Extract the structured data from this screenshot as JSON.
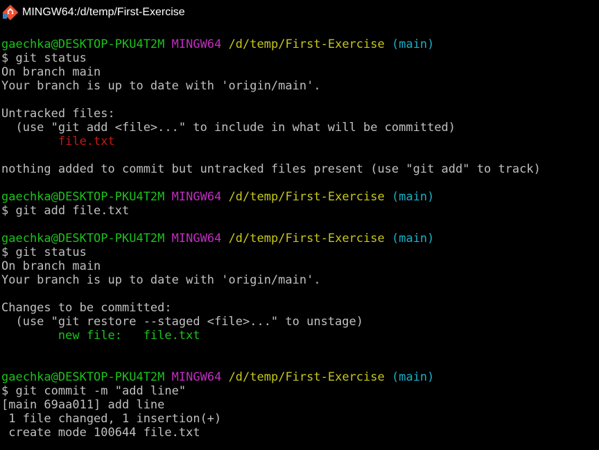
{
  "window": {
    "title": "MINGW64:/d/temp/First-Exercise",
    "icon": "git-bash-icon"
  },
  "colors": {
    "background": "#000000",
    "text": "#c0c0c0",
    "green": "#1cc21c",
    "magenta": "#c02dc0",
    "yellow": "#c8c81c",
    "cyan": "#1ab0c8",
    "red": "#c41818"
  },
  "prompt": {
    "user_host": "gaechka@DESKTOP-PKU4T2M",
    "shell": "MINGW64",
    "path": "/d/temp/First-Exercise",
    "branch": "(main)"
  },
  "terminal": {
    "lines": [
      [
        {
          "t": "gaechka@DESKTOP-PKU4T2M",
          "c": "green"
        },
        {
          "t": " ",
          "c": "white"
        },
        {
          "t": "MINGW64",
          "c": "magenta"
        },
        {
          "t": " ",
          "c": "white"
        },
        {
          "t": "/d/temp/First-Exercise",
          "c": "yellow"
        },
        {
          "t": " ",
          "c": "white"
        },
        {
          "t": "(main)",
          "c": "cyan"
        }
      ],
      [
        {
          "t": "$ git status",
          "c": "white"
        }
      ],
      [
        {
          "t": "On branch main",
          "c": "white"
        }
      ],
      [
        {
          "t": "Your branch is up to date with 'origin/main'.",
          "c": "white"
        }
      ],
      [],
      [
        {
          "t": "Untracked files:",
          "c": "white"
        }
      ],
      [
        {
          "t": "  (use \"git add <file>...\" to include in what will be committed)",
          "c": "white"
        }
      ],
      [
        {
          "t": "        file.txt",
          "c": "red"
        }
      ],
      [],
      [
        {
          "t": "nothing added to commit but untracked files present (use \"git add\" to track)",
          "c": "white"
        }
      ],
      [],
      [
        {
          "t": "gaechka@DESKTOP-PKU4T2M",
          "c": "green"
        },
        {
          "t": " ",
          "c": "white"
        },
        {
          "t": "MINGW64",
          "c": "magenta"
        },
        {
          "t": " ",
          "c": "white"
        },
        {
          "t": "/d/temp/First-Exercise",
          "c": "yellow"
        },
        {
          "t": " ",
          "c": "white"
        },
        {
          "t": "(main)",
          "c": "cyan"
        }
      ],
      [
        {
          "t": "$ git add file.txt",
          "c": "white"
        }
      ],
      [],
      [
        {
          "t": "gaechka@DESKTOP-PKU4T2M",
          "c": "green"
        },
        {
          "t": " ",
          "c": "white"
        },
        {
          "t": "MINGW64",
          "c": "magenta"
        },
        {
          "t": " ",
          "c": "white"
        },
        {
          "t": "/d/temp/First-Exercise",
          "c": "yellow"
        },
        {
          "t": " ",
          "c": "white"
        },
        {
          "t": "(main)",
          "c": "cyan"
        }
      ],
      [
        {
          "t": "$ git status",
          "c": "white"
        }
      ],
      [
        {
          "t": "On branch main",
          "c": "white"
        }
      ],
      [
        {
          "t": "Your branch is up to date with 'origin/main'.",
          "c": "white"
        }
      ],
      [],
      [
        {
          "t": "Changes to be committed:",
          "c": "white"
        }
      ],
      [
        {
          "t": "  (use \"git restore --staged <file>...\" to unstage)",
          "c": "white"
        }
      ],
      [
        {
          "t": "        new file:   file.txt",
          "c": "green"
        }
      ],
      [],
      [],
      [
        {
          "t": "gaechka@DESKTOP-PKU4T2M",
          "c": "green"
        },
        {
          "t": " ",
          "c": "white"
        },
        {
          "t": "MINGW64",
          "c": "magenta"
        },
        {
          "t": " ",
          "c": "white"
        },
        {
          "t": "/d/temp/First-Exercise",
          "c": "yellow"
        },
        {
          "t": " ",
          "c": "white"
        },
        {
          "t": "(main)",
          "c": "cyan"
        }
      ],
      [
        {
          "t": "$ git commit -m \"add line\"",
          "c": "white"
        }
      ],
      [
        {
          "t": "[main 69aa011] add line",
          "c": "white"
        }
      ],
      [
        {
          "t": " 1 file changed, 1 insertion(+)",
          "c": "white"
        }
      ],
      [
        {
          "t": " create mode 100644 file.txt",
          "c": "white"
        }
      ]
    ]
  }
}
